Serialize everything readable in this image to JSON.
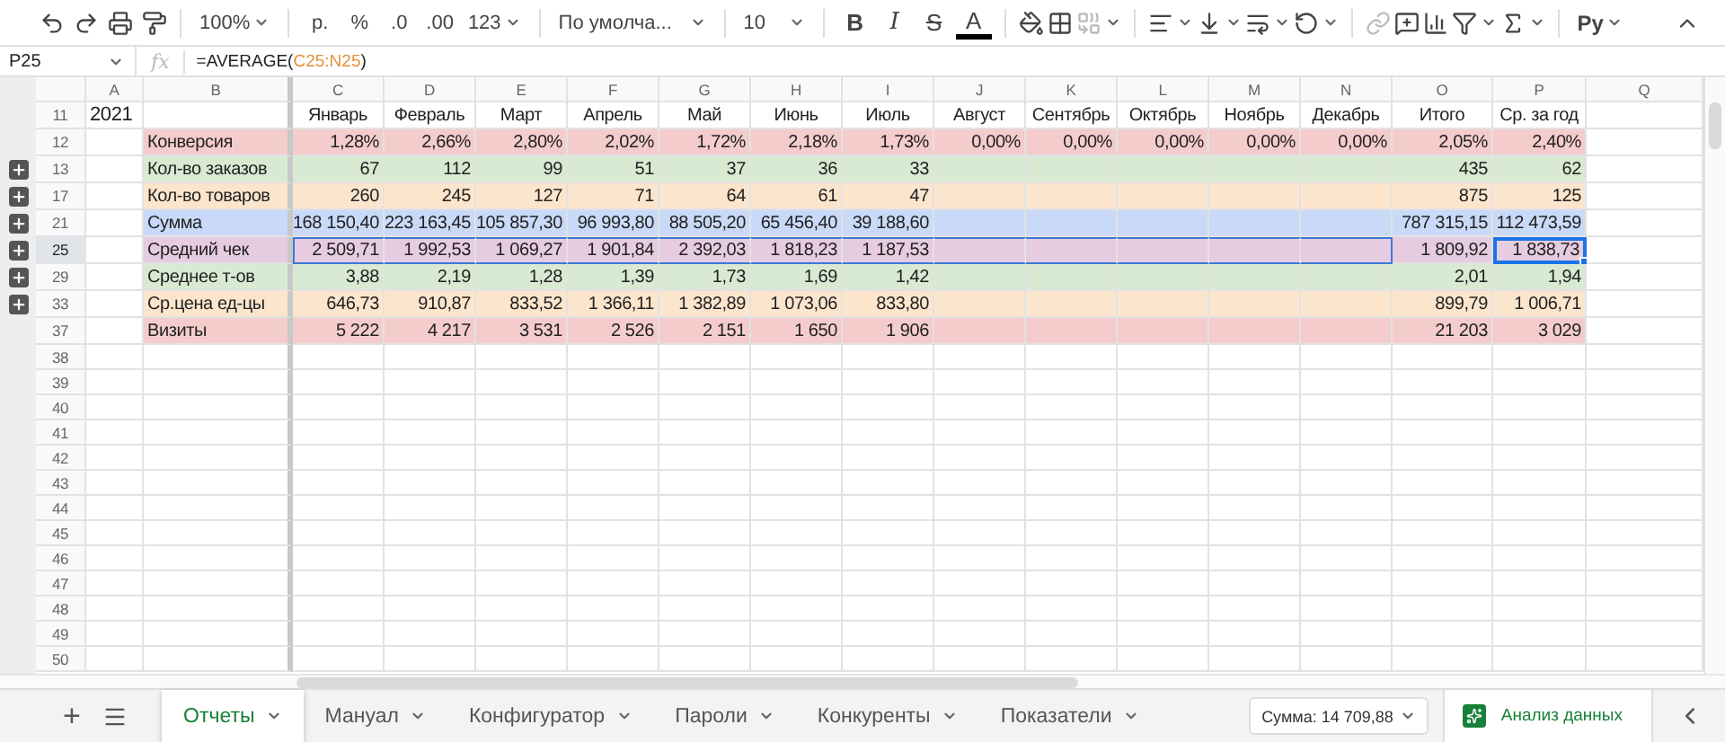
{
  "toolbar": {
    "zoom": "100%",
    "currency": "р.",
    "percent": "%",
    "decrease_decimals": ".0",
    "increase_decimals": ".00",
    "number_format": "123",
    "font": "По умолча...",
    "font_size": "10",
    "bold": "B",
    "italic": "I",
    "strikethrough": "S",
    "text_color": "A",
    "input_tools": "Ру"
  },
  "formula_bar": {
    "cell": "P25",
    "fx": "fx",
    "formula_start": "=AVERAGE(",
    "formula_ref": "C25:N25",
    "formula_end": ")"
  },
  "columns": [
    "A",
    "B",
    "C",
    "D",
    "E",
    "F",
    "G",
    "H",
    "I",
    "J",
    "K",
    "L",
    "M",
    "N",
    "O",
    "P",
    "Q"
  ],
  "sheet": {
    "header_row": "11",
    "year": "2021",
    "months": [
      "Январь",
      "Февраль",
      "Март",
      "Апрель",
      "Май",
      "Июнь",
      "Июль",
      "Август",
      "Сентябрь",
      "Октябрь",
      "Ноябрь",
      "Декабрь"
    ],
    "total_header": "Итого",
    "average_header": "Ср. за год",
    "rows": [
      {
        "number": "12",
        "label": "Конверсия",
        "color": "#f4cccc",
        "group": false,
        "highlighted": false,
        "selected": false,
        "values": [
          "1,28%",
          "2,66%",
          "2,80%",
          "2,02%",
          "1,72%",
          "2,18%",
          "1,73%",
          "0,00%",
          "0,00%",
          "0,00%",
          "0,00%",
          "0,00%"
        ],
        "total": "2,05%",
        "average": "2,40%"
      },
      {
        "number": "13",
        "label": "Кол-во заказов",
        "color": "#d9ead3",
        "group": true,
        "highlighted": false,
        "selected": false,
        "values": [
          "67",
          "112",
          "99",
          "51",
          "37",
          "36",
          "33"
        ],
        "total": "435",
        "average": "62"
      },
      {
        "number": "17",
        "label": "Кол-во товаров",
        "color": "#fce5cd",
        "group": true,
        "highlighted": false,
        "selected": false,
        "values": [
          "260",
          "245",
          "127",
          "71",
          "64",
          "61",
          "47"
        ],
        "total": "875",
        "average": "125"
      },
      {
        "number": "21",
        "label": "Сумма",
        "color": "#c9daf8",
        "group": true,
        "highlighted": false,
        "selected": false,
        "values": [
          "168 150,40",
          "223 163,45",
          "105 857,30",
          "96 993,80",
          "88 505,20",
          "65 456,40",
          "39 188,60"
        ],
        "total": "787 315,15",
        "average": "112 473,59"
      },
      {
        "number": "25",
        "label": "Средний чек",
        "color": "#e6cce0",
        "group": true,
        "highlighted": true,
        "selected": true,
        "values": [
          "2 509,71",
          "1 992,53",
          "1 069,27",
          "1 901,84",
          "2 392,03",
          "1 818,23",
          "1 187,53"
        ],
        "total": "1 809,92",
        "average": "1 838,73"
      },
      {
        "number": "29",
        "label": "Среднее т-ов",
        "color": "#d9ead3",
        "group": true,
        "highlighted": false,
        "selected": false,
        "values": [
          "3,88",
          "2,19",
          "1,28",
          "1,39",
          "1,73",
          "1,69",
          "1,42"
        ],
        "total": "2,01",
        "average": "1,94"
      },
      {
        "number": "33",
        "label": "Ср.цена ед-цы",
        "color": "#fce5cd",
        "group": true,
        "highlighted": false,
        "selected": false,
        "values": [
          "646,73",
          "910,87",
          "833,52",
          "1 366,11",
          "1 382,89",
          "1 073,06",
          "833,80"
        ],
        "total": "899,79",
        "average": "1 006,71"
      },
      {
        "number": "37",
        "label": "Визиты",
        "color": "#f4cccc",
        "group": false,
        "highlighted": false,
        "selected": false,
        "values": [
          "5 222",
          "4 217",
          "3 531",
          "2 526",
          "2 151",
          "1 650",
          "1 906"
        ],
        "total": "21 203",
        "average": "3 029"
      }
    ],
    "empty_rows": [
      "38",
      "39",
      "40",
      "41",
      "42",
      "43",
      "44",
      "45",
      "46",
      "47",
      "48",
      "49",
      "50"
    ]
  },
  "bottom_bar": {
    "add": "+",
    "sheets": [
      {
        "label": "Отчеты",
        "selected": true
      },
      {
        "label": "Мануал",
        "selected": false
      },
      {
        "label": "Конфигуратор",
        "selected": false
      },
      {
        "label": "Пароли",
        "selected": false
      },
      {
        "label": "Конкуренты",
        "selected": false
      },
      {
        "label": "Показатели",
        "selected": false
      }
    ],
    "sum": "Сумма: 14 709,88",
    "explore": "Анализ данных"
  }
}
